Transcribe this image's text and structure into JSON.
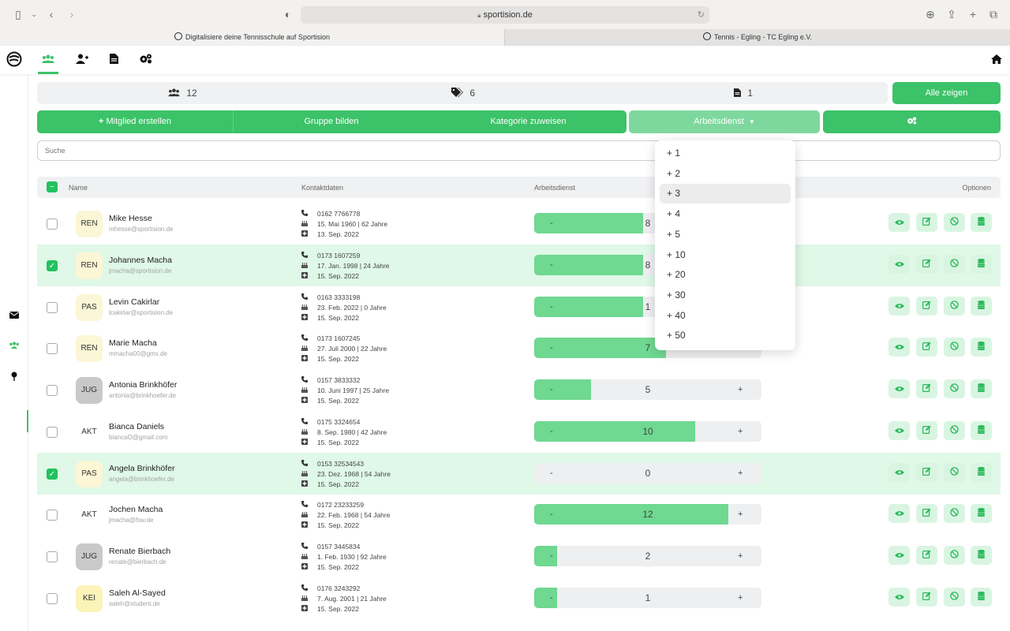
{
  "browser": {
    "url": "sportision.de",
    "tabs": [
      {
        "label": "Digitalisiere deine Tennisschule auf Sportision",
        "active": true
      },
      {
        "label": "Tennis - Egling - TC Egling e.V.",
        "active": false
      }
    ]
  },
  "nav": {
    "items": [
      "members-icon",
      "add-member-icon",
      "document-icon",
      "settings-icon"
    ],
    "home": "home-icon"
  },
  "sidebar": {
    "items": [
      "mail-icon",
      "members-icon",
      "pin-icon"
    ]
  },
  "stats": {
    "members": "12",
    "tags": "6",
    "documents": "1",
    "show_all": "Alle zeigen"
  },
  "actions": {
    "create_member": "Mitglied erstellen",
    "form_group": "Gruppe bilden",
    "assign_category": "Kategorie zuweisen",
    "work_duty": "Arbeitsdienst"
  },
  "search": {
    "placeholder": "Suche"
  },
  "table": {
    "headers": {
      "name": "Name",
      "contact": "Kontaktdaten",
      "duty": "Arbeitsdienst",
      "options": "Optionen"
    },
    "rows": [
      {
        "checked": false,
        "cat": "REN",
        "cat_color": "#fbf6d5",
        "name": "Mike Hesse",
        "email": "mhesse@sportision.de",
        "phone": "0162 7766778",
        "birth": "15. Mai 1960 | 62 Jahre",
        "joined": "13. Sep. 2022",
        "duty_value": "8",
        "duty_fill": 0.48
      },
      {
        "checked": true,
        "cat": "REN",
        "cat_color": "#fbf6d5",
        "name": "Johannes Macha",
        "email": "jmacha@sportision.de",
        "phone": "0173 1607259",
        "birth": "17. Jan. 1998 | 24 Jahre",
        "joined": "15. Sep. 2022",
        "duty_value": "8",
        "duty_fill": 0.48
      },
      {
        "checked": false,
        "cat": "PAS",
        "cat_color": "#fbf6d5",
        "name": "Levin Cakirlar",
        "email": "lcakirlar@sportision.de",
        "phone": "0163 3333198",
        "birth": "23. Feb. 2022 | 0 Jahre",
        "joined": "15. Sep. 2022",
        "duty_value": "1",
        "duty_fill": 0.48
      },
      {
        "checked": false,
        "cat": "REN",
        "cat_color": "#fbf6d5",
        "name": "Marie Macha",
        "email": "mmacha00@gmx.de",
        "phone": "0173 1607245",
        "birth": "27. Juli 2000 | 22 Jahre",
        "joined": "15. Sep. 2022",
        "duty_value": "7",
        "duty_fill": 0.58
      },
      {
        "checked": false,
        "cat": "JUG",
        "cat_color": "#c9c9c9",
        "name": "Antonia Brinkhöfer",
        "email": "antonia@brinkhoefer.de",
        "phone": "0157 3833332",
        "birth": "10. Juni 1997 | 25 Jahre",
        "joined": "15. Sep. 2022",
        "duty_value": "5",
        "duty_fill": 0.25
      },
      {
        "checked": false,
        "cat": "AKT",
        "cat_color": "#ffffff",
        "name": "Bianca Daniels",
        "email": "biancaO@gmail.com",
        "phone": "0175 3324654",
        "birth": "8. Sep. 1980 | 42 Jahre",
        "joined": "15. Sep. 2022",
        "duty_value": "10",
        "duty_fill": 0.71
      },
      {
        "checked": true,
        "cat": "PAS",
        "cat_color": "#fbf6d5",
        "name": "Angela Brinkhöfer",
        "email": "angela@brinkhoefer.de",
        "phone": "0153 32534543",
        "birth": "23. Dez. 1968 | 54 Jahre",
        "joined": "15. Sep. 2022",
        "duty_value": "0",
        "duty_fill": 0.0
      },
      {
        "checked": false,
        "cat": "AKT",
        "cat_color": "#ffffff",
        "name": "Jochen Macha",
        "email": "jmacha@fsw.de",
        "phone": "0172 23233259",
        "birth": "22. Feb. 1968 | 54 Jahre",
        "joined": "15. Sep. 2022",
        "duty_value": "12",
        "duty_fill": 0.855
      },
      {
        "checked": false,
        "cat": "JUG",
        "cat_color": "#c9c9c9",
        "name": "Renate Bierbach",
        "email": "renate@bierbach.de",
        "phone": "0157 3445834",
        "birth": "1. Feb. 1930 | 92 Jahre",
        "joined": "15. Sep. 2022",
        "duty_value": "2",
        "duty_fill": 0.1
      },
      {
        "checked": false,
        "cat": "KEI",
        "cat_color": "#fbf3b8",
        "name": "Saleh Al-Sayed",
        "email": "saleh@student.de",
        "phone": "0176 3243292",
        "birth": "7. Aug. 2001 | 21 Jahre",
        "joined": "15. Sep. 2022",
        "duty_value": "1",
        "duty_fill": 0.1
      }
    ]
  },
  "dropdown": {
    "items": [
      "+ 1",
      "+ 2",
      "+ 3",
      "+ 4",
      "+ 5",
      "+ 10",
      "+ 20",
      "+ 30",
      "+ 40",
      "+ 50"
    ],
    "highlighted": 2
  },
  "colors": {
    "accent": "#3cc268",
    "fill": "#6fd891",
    "selected_row": "#dff8e7"
  }
}
